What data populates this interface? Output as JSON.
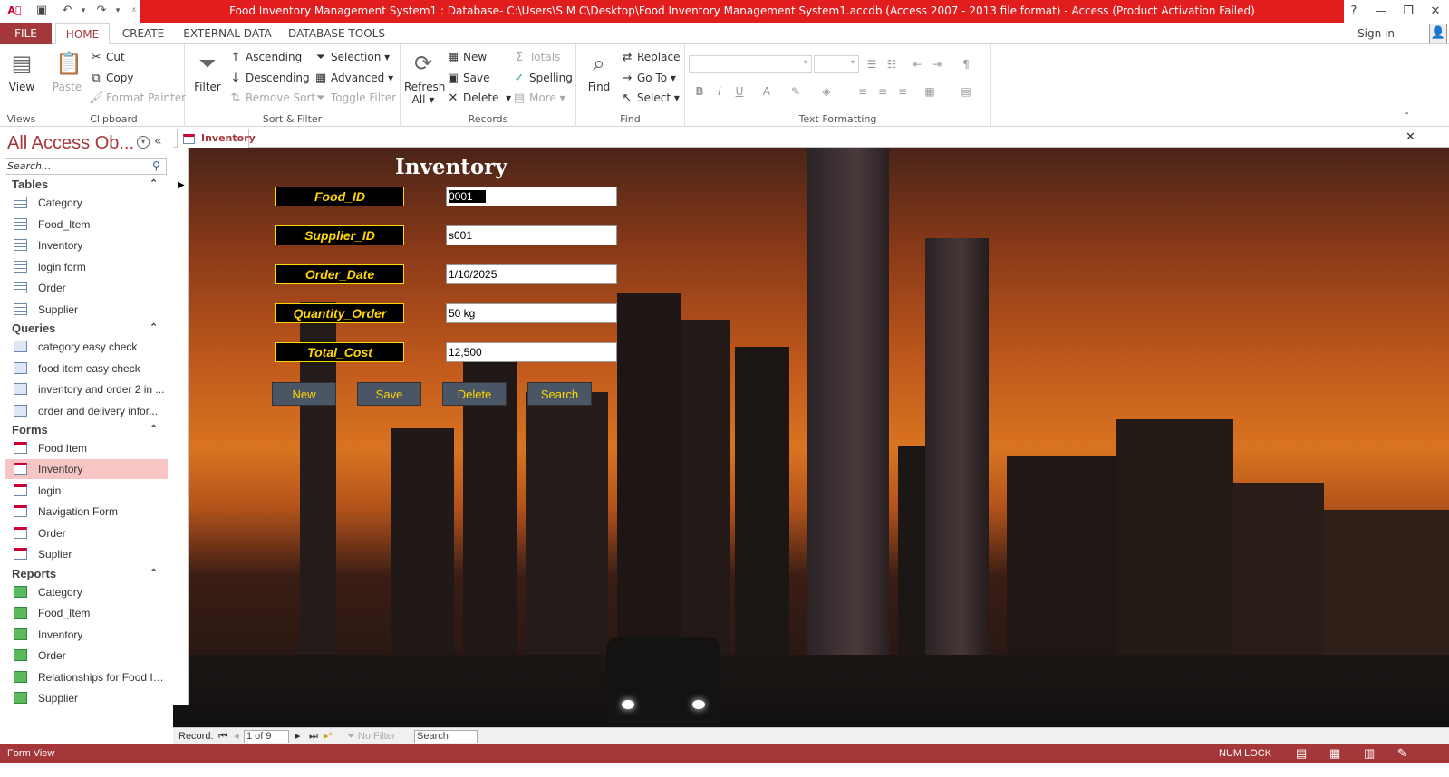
{
  "window": {
    "title": "Food Inventory Management System1 : Database- C:\\Users\\S M C\\Desktop\\Food Inventory Management System1.accdb (Access 2007 - 2013 file format) -  Access (Product Activation Failed)",
    "help": "?",
    "minimize": "—",
    "restore": "❐",
    "close": "✕"
  },
  "ribbon_tabs": {
    "file": "FILE",
    "home": "HOME",
    "create": "CREATE",
    "external": "EXTERNAL DATA",
    "dbtools": "DATABASE TOOLS"
  },
  "signin": "Sign in",
  "ribbon": {
    "views": {
      "view": "View",
      "label": "Views"
    },
    "clipboard": {
      "paste": "Paste",
      "cut": "Cut",
      "copy": "Copy",
      "format_painter": "Format Painter",
      "label": "Clipboard"
    },
    "sort_filter": {
      "filter": "Filter",
      "ascending": "Ascending",
      "descending": "Descending",
      "remove_sort": "Remove Sort",
      "selection": "Selection",
      "advanced": "Advanced",
      "toggle_filter": "Toggle Filter",
      "label": "Sort & Filter"
    },
    "records": {
      "refresh": "Refresh",
      "refresh2": "All",
      "new": "New",
      "save": "Save",
      "delete": "Delete",
      "totals": "Totals",
      "spelling": "Spelling",
      "more": "More",
      "label": "Records"
    },
    "find": {
      "find": "Find",
      "replace": "Replace",
      "goto": "Go To",
      "select": "Select",
      "label": "Find"
    },
    "text_formatting": {
      "label": "Text Formatting",
      "bold": "B",
      "italic": "I",
      "underline": "U",
      "fontcolor": "A"
    }
  },
  "nav": {
    "title": "All Access Ob...",
    "search_placeholder": "Search...",
    "groups": {
      "tables": {
        "label": "Tables",
        "items": [
          "Category",
          "Food_Item",
          "Inventory",
          "login form",
          "Order",
          "Supplier"
        ]
      },
      "queries": {
        "label": "Queries",
        "items": [
          "category easy check",
          "food item easy check",
          "inventory and order 2 in ...",
          "order and delivery  infor..."
        ]
      },
      "forms": {
        "label": "Forms",
        "items": [
          "Food Item",
          "Inventory",
          "login",
          "Navigation Form",
          "Order",
          "Suplier"
        ]
      },
      "reports": {
        "label": "Reports",
        "items": [
          "Category",
          "Food_Item",
          "Inventory",
          "Order",
          "Relationships for Food In...",
          "Supplier"
        ]
      }
    }
  },
  "doc_tab": "Inventory",
  "form": {
    "title": "Inventory",
    "fields": {
      "food_id": {
        "label": "Food_ID",
        "value": "0001"
      },
      "supplier_id": {
        "label": "Supplier_ID",
        "value": "s001"
      },
      "order_date": {
        "label": "Order_Date",
        "value": "1/10/2025"
      },
      "quantity": {
        "label": "Quantity_Order",
        "value": "50 kg"
      },
      "total_cost": {
        "label": "Total_Cost",
        "value": "12,500"
      }
    },
    "buttons": {
      "new": "New",
      "save": "Save",
      "delete": "Delete",
      "search": "Search"
    }
  },
  "record_nav": {
    "record_label": "Record:",
    "position": "1 of 9",
    "no_filter": "No Filter",
    "search": "Search"
  },
  "status": {
    "left": "Form View",
    "numlock": "NUM LOCK"
  }
}
